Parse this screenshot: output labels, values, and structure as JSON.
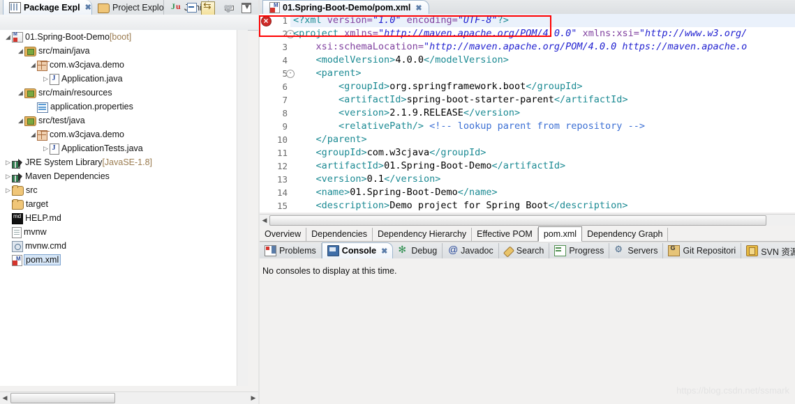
{
  "explorer": {
    "tabs": [
      {
        "label": "Package Expl",
        "icon": "package-explorer-icon",
        "active": true,
        "closable": true
      },
      {
        "label": "Project Explo",
        "icon": "project-explorer-icon",
        "active": false,
        "closable": false
      },
      {
        "label": "JUnit",
        "icon": "junit-icon",
        "active": false,
        "closable": false
      }
    ],
    "toolbar": {
      "collapse_all": "collapse-all-icon",
      "link_with_editor": "link-with-editor-icon",
      "view_filters": "view-filters-icon",
      "view_menu": "view-menu-icon"
    },
    "window_buttons": {
      "minimize": "minimize-icon",
      "maximize": "maximize-icon"
    },
    "tree": [
      {
        "indent": 0,
        "arrow": "open",
        "icon": "maven-project-icon",
        "label": "01.Spring-Boot-Demo",
        "suffix": "[boot]"
      },
      {
        "indent": 1,
        "arrow": "open",
        "icon": "source-folder-icon",
        "label": "src/main/java",
        "suffix": ""
      },
      {
        "indent": 2,
        "arrow": "open",
        "icon": "package-icon",
        "label": "com.w3cjava.demo",
        "suffix": ""
      },
      {
        "indent": 3,
        "arrow": "closed",
        "icon": "java-file-icon",
        "label": "Application.java",
        "suffix": ""
      },
      {
        "indent": 1,
        "arrow": "open",
        "icon": "source-folder-icon",
        "label": "src/main/resources",
        "suffix": ""
      },
      {
        "indent": 2,
        "arrow": "none",
        "icon": "properties-file-icon",
        "label": "application.properties",
        "suffix": ""
      },
      {
        "indent": 1,
        "arrow": "open",
        "icon": "source-folder-icon",
        "label": "src/test/java",
        "suffix": ""
      },
      {
        "indent": 2,
        "arrow": "open",
        "icon": "package-icon",
        "label": "com.w3cjava.demo",
        "suffix": ""
      },
      {
        "indent": 3,
        "arrow": "closed",
        "icon": "java-file-icon",
        "label": "ApplicationTests.java",
        "suffix": ""
      },
      {
        "indent": 0,
        "arrow": "closed",
        "icon": "library-icon",
        "label": "JRE System Library",
        "suffix": "[JavaSE-1.8]"
      },
      {
        "indent": 0,
        "arrow": "closed",
        "icon": "library-icon",
        "label": "Maven Dependencies",
        "suffix": ""
      },
      {
        "indent": 0,
        "arrow": "closed",
        "icon": "folder-icon",
        "label": "src",
        "suffix": ""
      },
      {
        "indent": 0,
        "arrow": "none",
        "icon": "folder-icon",
        "label": "target",
        "suffix": ""
      },
      {
        "indent": 0,
        "arrow": "none",
        "icon": "markdown-file-icon",
        "label": "HELP.md",
        "suffix": ""
      },
      {
        "indent": 0,
        "arrow": "none",
        "icon": "text-file-icon",
        "label": "mvnw",
        "suffix": ""
      },
      {
        "indent": 0,
        "arrow": "none",
        "icon": "cmd-file-icon",
        "label": "mvnw.cmd",
        "suffix": ""
      },
      {
        "indent": 0,
        "arrow": "none",
        "icon": "pom-file-icon",
        "label": "pom.xml",
        "suffix": "",
        "selected": true
      }
    ]
  },
  "editor": {
    "tab": {
      "label": "01.Spring-Boot-Demo/pom.xml",
      "icon": "pom-file-icon",
      "close": "✖"
    },
    "error_marker": "error-icon",
    "lines": [
      {
        "num": "1",
        "fold": "",
        "error": true,
        "highlight": true,
        "parts": [
          {
            "t": "<?xml ",
            "c": "pi"
          },
          {
            "t": "version=",
            "c": "at"
          },
          {
            "t": "\"1.0\"",
            "c": "av"
          },
          {
            "t": " ",
            "c": "tx"
          },
          {
            "t": "encoding=",
            "c": "at"
          },
          {
            "t": "\"UTF-8\"",
            "c": "av"
          },
          {
            "t": "?>",
            "c": "pi"
          }
        ]
      },
      {
        "num": "2",
        "fold": "-",
        "parts": [
          {
            "t": "<project ",
            "c": "tg"
          },
          {
            "t": "xmlns=",
            "c": "at"
          },
          {
            "t": "\"http://maven.apache.org/POM/4.0.0\"",
            "c": "av"
          },
          {
            "t": " ",
            "c": "tx"
          },
          {
            "t": "xmlns:xsi=",
            "c": "at"
          },
          {
            "t": "\"http://www.w3.org/",
            "c": "av"
          }
        ]
      },
      {
        "num": "3",
        "fold": "",
        "parts": [
          {
            "t": "    ",
            "c": "tx"
          },
          {
            "t": "xsi:schemaLocation=",
            "c": "at"
          },
          {
            "t": "\"http://maven.apache.org/POM/4.0.0 https://maven.apache.o",
            "c": "av"
          }
        ]
      },
      {
        "num": "4",
        "fold": "",
        "parts": [
          {
            "t": "    ",
            "c": "tx"
          },
          {
            "t": "<modelVersion>",
            "c": "tg"
          },
          {
            "t": "4.0.0",
            "c": "tx"
          },
          {
            "t": "</modelVersion>",
            "c": "tg"
          }
        ]
      },
      {
        "num": "5",
        "fold": "-",
        "parts": [
          {
            "t": "    ",
            "c": "tx"
          },
          {
            "t": "<parent>",
            "c": "tg"
          }
        ]
      },
      {
        "num": "6",
        "fold": "",
        "parts": [
          {
            "t": "        ",
            "c": "tx"
          },
          {
            "t": "<groupId>",
            "c": "tg"
          },
          {
            "t": "org.springframework.boot",
            "c": "tx"
          },
          {
            "t": "</groupId>",
            "c": "tg"
          }
        ]
      },
      {
        "num": "7",
        "fold": "",
        "parts": [
          {
            "t": "        ",
            "c": "tx"
          },
          {
            "t": "<artifactId>",
            "c": "tg"
          },
          {
            "t": "spring-boot-starter-parent",
            "c": "tx"
          },
          {
            "t": "</artifactId>",
            "c": "tg"
          }
        ]
      },
      {
        "num": "8",
        "fold": "",
        "parts": [
          {
            "t": "        ",
            "c": "tx"
          },
          {
            "t": "<version>",
            "c": "tg"
          },
          {
            "t": "2.1.9.RELEASE",
            "c": "tx"
          },
          {
            "t": "</version>",
            "c": "tg"
          }
        ]
      },
      {
        "num": "9",
        "fold": "",
        "parts": [
          {
            "t": "        ",
            "c": "tx"
          },
          {
            "t": "<relativePath/>",
            "c": "tg"
          },
          {
            "t": " ",
            "c": "tx"
          },
          {
            "t": "<!-- lookup parent from repository -->",
            "c": "cm"
          }
        ]
      },
      {
        "num": "10",
        "fold": "",
        "parts": [
          {
            "t": "    ",
            "c": "tx"
          },
          {
            "t": "</parent>",
            "c": "tg"
          }
        ]
      },
      {
        "num": "11",
        "fold": "",
        "parts": [
          {
            "t": "    ",
            "c": "tx"
          },
          {
            "t": "<groupId>",
            "c": "tg"
          },
          {
            "t": "com.w3cjava",
            "c": "tx"
          },
          {
            "t": "</groupId>",
            "c": "tg"
          }
        ]
      },
      {
        "num": "12",
        "fold": "",
        "parts": [
          {
            "t": "    ",
            "c": "tx"
          },
          {
            "t": "<artifactId>",
            "c": "tg"
          },
          {
            "t": "01.Spring-Boot-Demo",
            "c": "tx"
          },
          {
            "t": "</artifactId>",
            "c": "tg"
          }
        ]
      },
      {
        "num": "13",
        "fold": "",
        "parts": [
          {
            "t": "    ",
            "c": "tx"
          },
          {
            "t": "<version>",
            "c": "tg"
          },
          {
            "t": "0.1",
            "c": "tx"
          },
          {
            "t": "</version>",
            "c": "tg"
          }
        ]
      },
      {
        "num": "14",
        "fold": "",
        "parts": [
          {
            "t": "    ",
            "c": "tx"
          },
          {
            "t": "<name>",
            "c": "tg"
          },
          {
            "t": "01.Spring-Boot-Demo",
            "c": "tx"
          },
          {
            "t": "</name>",
            "c": "tg"
          }
        ]
      },
      {
        "num": "15",
        "fold": "",
        "parts": [
          {
            "t": "    ",
            "c": "tx"
          },
          {
            "t": "<description>",
            "c": "tg"
          },
          {
            "t": "Demo project for Spring Boot",
            "c": "tx"
          },
          {
            "t": "</description>",
            "c": "tg"
          }
        ]
      }
    ],
    "pom_tabs": [
      {
        "label": "Overview",
        "selected": false
      },
      {
        "label": "Dependencies",
        "selected": false
      },
      {
        "label": "Dependency Hierarchy",
        "selected": false
      },
      {
        "label": "Effective POM",
        "selected": false
      },
      {
        "label": "pom.xml",
        "selected": true
      },
      {
        "label": "Dependency Graph",
        "selected": false
      }
    ]
  },
  "bottom": {
    "tabs": [
      {
        "label": "Problems",
        "icon": "problems-icon",
        "active": false,
        "closable": false
      },
      {
        "label": "Console",
        "icon": "console-icon",
        "active": true,
        "closable": true
      },
      {
        "label": "Debug",
        "icon": "debug-icon",
        "active": false,
        "closable": false
      },
      {
        "label": "Javadoc",
        "icon": "javadoc-icon",
        "active": false,
        "closable": false
      },
      {
        "label": "Search",
        "icon": "search-icon",
        "active": false,
        "closable": false
      },
      {
        "label": "Progress",
        "icon": "progress-icon",
        "active": false,
        "closable": false
      },
      {
        "label": "Servers",
        "icon": "servers-icon",
        "active": false,
        "closable": false
      },
      {
        "label": "Git Repositori",
        "icon": "git-repositories-icon",
        "active": false,
        "closable": false
      },
      {
        "label": "SVN 资源库",
        "icon": "svn-icon",
        "active": false,
        "closable": false
      }
    ],
    "message": "No consoles to display at this time."
  },
  "watermark": "https://blog.csdn.net/ssmark",
  "colors": {
    "annotation_red": "#ff0000",
    "tag": "#1b8a93",
    "attribute_value": "#2020d0",
    "comment": "#3b6fd4",
    "selection": "#d6e6f7",
    "error": "#cf2a27"
  }
}
